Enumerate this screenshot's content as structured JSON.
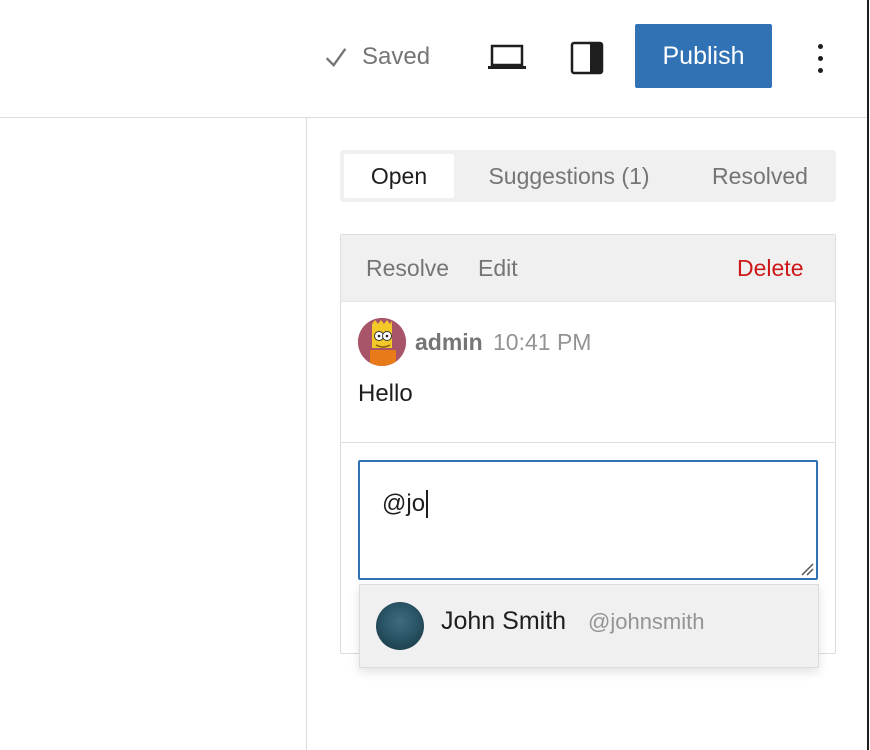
{
  "header": {
    "saved_label": "Saved",
    "publish_label": "Publish"
  },
  "icons": {
    "saved": "check-icon",
    "preview": "laptop-icon",
    "sidebar": "sidebar-panel-icon",
    "more": "vertical-ellipsis-icon"
  },
  "colors": {
    "accent": "#3072b4",
    "delete": "#cc1818",
    "muted": "#757575"
  },
  "tabs": [
    {
      "label": "Open",
      "active": true
    },
    {
      "label": "Suggestions (1)",
      "active": false
    },
    {
      "label": "Resolved",
      "active": false
    }
  ],
  "comment": {
    "actions": {
      "resolve": "Resolve",
      "edit": "Edit",
      "delete": "Delete"
    },
    "author": "admin",
    "time": "10:41 PM",
    "text": "Hello"
  },
  "reply": {
    "value": "@jo"
  },
  "mention": {
    "name": "John Smith",
    "handle": "@johnsmith"
  }
}
